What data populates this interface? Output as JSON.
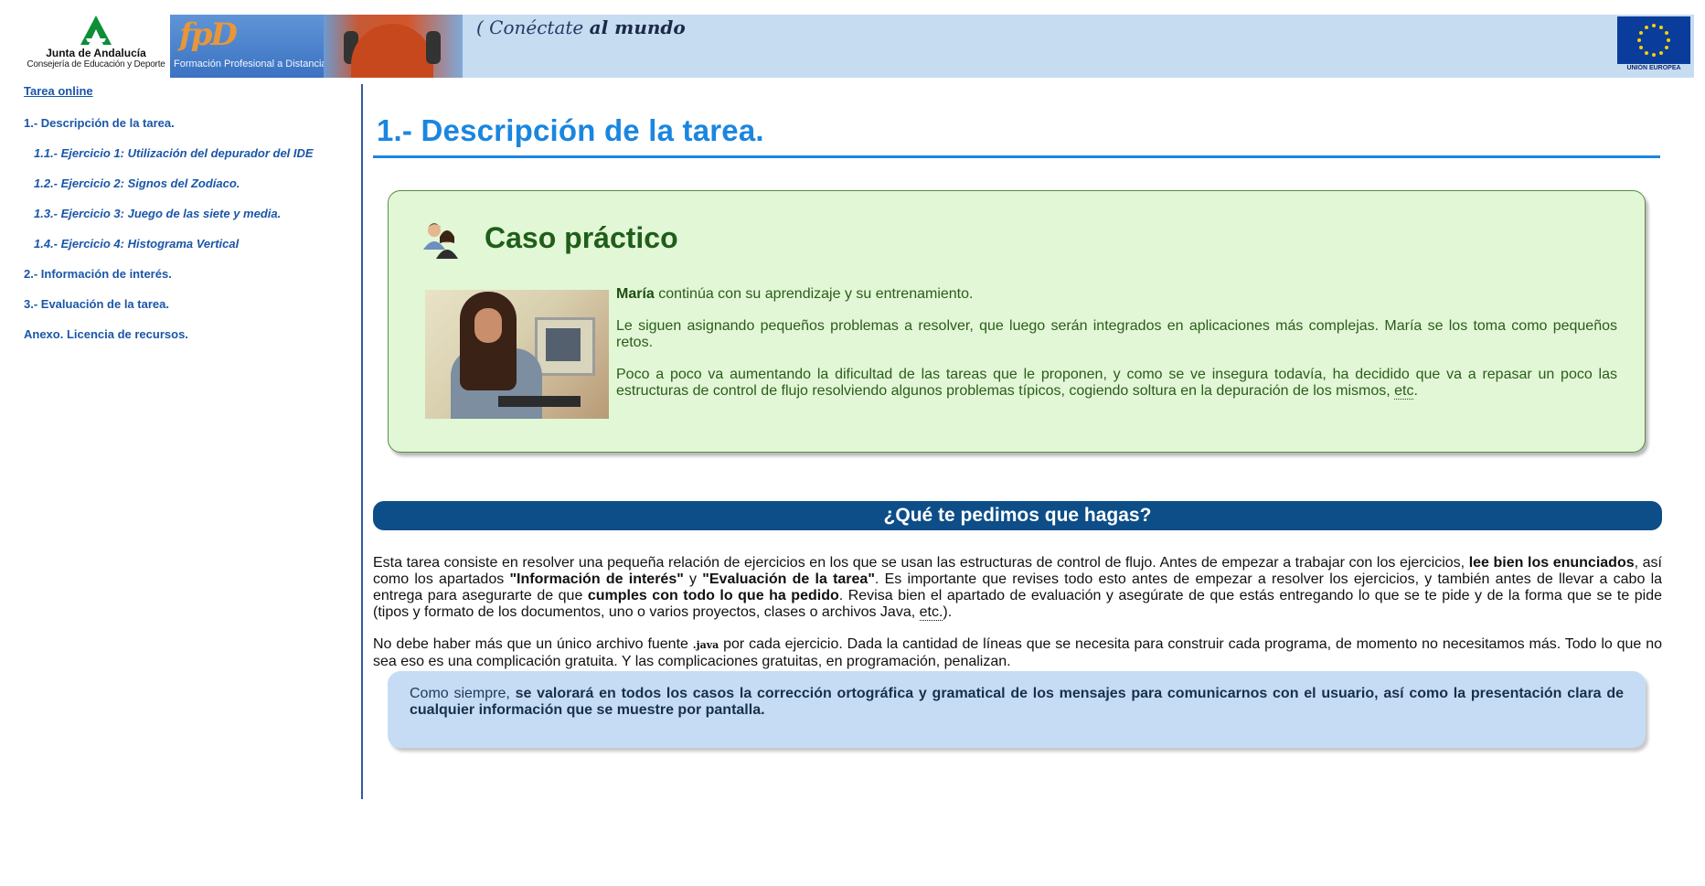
{
  "header": {
    "junta_name": "Junta de Andalucía",
    "junta_sub": "Consejería de Educación y Deporte",
    "fpd_logo": "fpD",
    "fpd_text": "Formación Profesional a Distancia",
    "slogan_part1": "Conéctate",
    "slogan_part2": "al mundo",
    "eu_label": "UNIÓN EUROPEA"
  },
  "sidebar": {
    "top_link": "Tarea online",
    "items": [
      {
        "label": "1.- Descripción de la tarea."
      },
      {
        "label": "1.1.- Ejercicio 1: Utilización del depurador del IDE"
      },
      {
        "label": "1.2.- Ejercicio 2: Signos del Zodíaco."
      },
      {
        "label": "1.3.- Ejercicio 3: Juego de las siete y media."
      },
      {
        "label": "1.4.- Ejercicio 4: Histograma Vertical"
      },
      {
        "label": "2.- Información de interés."
      },
      {
        "label": "3.- Evaluación de la tarea."
      },
      {
        "label": "Anexo. Licencia de recursos."
      }
    ]
  },
  "main": {
    "title": "1.- Descripción de la tarea.",
    "caso": {
      "title": "Caso práctico",
      "p1_name": "María",
      "p1_rest": " continúa con su aprendizaje y su entrenamiento.",
      "p2": "Le siguen asignando pequeños problemas a resolver, que luego serán integrados en aplicaciones más complejas. María se los toma como pequeños retos.",
      "p3_text": "Poco a poco va aumentando la dificultad de las tareas que le proponen, y como se ve insegura todavía, ha decidido que va a repasar un poco las estructuras de control de flujo resolviendo algunos problemas típicos, cogiendo soltura en la depuración de los mismos, ",
      "p3_abbr": "etc",
      "p3_end": "."
    },
    "question_heading": "¿Qué te pedimos que hagas?",
    "body": {
      "p1_a": "Esta tarea consiste en resolver una pequeña relación de ejercicios en los que se usan las estructuras de control de flujo. Antes de empezar a trabajar con los ejercicios, ",
      "p1_b": "lee bien los enunciados",
      "p1_c": ", así como los apartados ",
      "p1_d": "\"Información de interés\"",
      "p1_e": " y ",
      "p1_f": "\"Evaluación de la tarea\"",
      "p1_g": ". Es importante que revises todo esto antes de empezar a resolver los ejercicios, y también antes de llevar a cabo la entrega para asegurarte de que ",
      "p1_h": "cumples con todo lo que ha pedido",
      "p1_i": ". Revisa bien el apartado de evaluación y asegúrate de que estás entregando lo que se te pide y de la forma que se te pide (tipos y formato de los documentos, uno o varios proyectos, clases o archivos Java, ",
      "p1_abbr": "etc.",
      "p1_j": ").",
      "p2_a": "No debe haber más que un único archivo fuente ",
      "p2_code": ".java",
      "p2_b": " por cada ejercicio. Dada la cantidad de líneas que se necesita para construir cada programa, de momento no necesitamos más. Todo lo que no sea eso es una complicación gratuita. Y las complicaciones gratuitas, en programación, penalizan."
    },
    "note": {
      "lead": "Como siempre, ",
      "bold": "se valorará en todos los casos la corrección ortográfica y gramatical de los mensajes para comunicarnos con el usuario, así como la presentación clara de cualquier información que se muestre por pantalla."
    }
  },
  "colors": {
    "title_blue": "#1a86e0",
    "link_blue": "#1a56a8",
    "caso_bg": "#e1f7d5",
    "heading_bar": "#0d4d88",
    "note_bg": "#c6dcf4"
  },
  "icons": [
    "junta-logo-icon",
    "users-icon",
    "eu-flag-icon"
  ]
}
